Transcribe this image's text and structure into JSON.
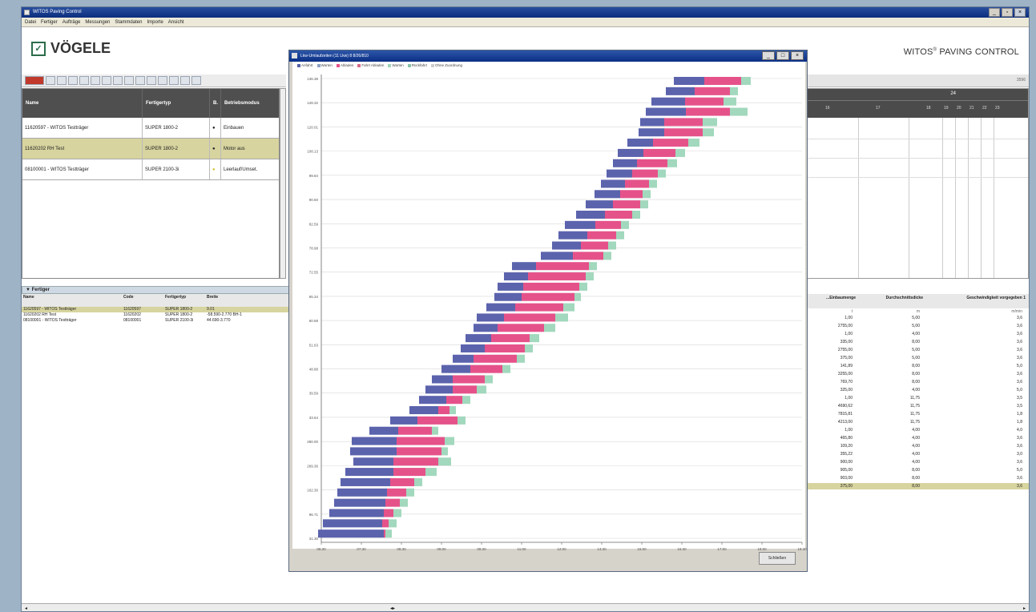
{
  "main_window": {
    "title": "WITOS Paving Control",
    "menu": [
      "Datei",
      "Fertiger",
      "Aufträge",
      "Messungen",
      "Stammdaten",
      "Importe",
      "Ansicht"
    ]
  },
  "brand": {
    "logo": "VÖGELE",
    "product": "WITOS",
    "product_sup": "®",
    "product_rest": " PAVING CONTROL"
  },
  "icons": [
    "window-minimize-icon",
    "window-maximize-icon",
    "window-close-icon",
    "logo-icon"
  ],
  "status_right": "3596",
  "top_grid": {
    "columns": [
      "Name",
      "Fertigertyp",
      "B.",
      "Betriebsmodus"
    ],
    "rows": [
      {
        "name": "11620597 - WITOS Testträger",
        "type": "SUPER 1800-2",
        "mode": "Einbauen",
        "dot": "#2a2a2a"
      },
      {
        "name": "11620202 RH Test",
        "type": "SUPER 1800-2",
        "mode": "Motor aus",
        "dot": "#2a2a2a"
      },
      {
        "name": "08100001 - WITOS Testträger",
        "type": "SUPER 2100-3i",
        "mode": "Leerlauf/Umset.",
        "dot": "#d6c23a"
      }
    ]
  },
  "fleet_panel": {
    "title": "Fertiger",
    "columns": [
      "Name",
      "Code",
      "Fertigertyp",
      "Breite"
    ],
    "rows": [
      {
        "name": "11620597 - WITOS Testträger",
        "code": "11620597",
        "type": "SUPER 1800-2",
        "width": "9.01"
      },
      {
        "name": "11620202 RH Test",
        "code": "11620202",
        "type": "SUPER 1800-2",
        "width": "-58.590-2.770 BH-1"
      },
      {
        "name": "08100001 - WITOS Testträger",
        "code": "08100001",
        "type": "SUPER 2100-3i",
        "width": "44.690-3.770"
      }
    ]
  },
  "timeline": {
    "week": "24",
    "days_left": [
      "16",
      "17",
      "18"
    ],
    "days_right": [
      "19",
      "20",
      "21",
      "22",
      "23"
    ]
  },
  "right_table": {
    "columns": [
      "...Einbaumenge",
      "Durchschnittsdicke",
      "Geschwindigkeit vorgegeben 1"
    ],
    "units": [
      "t",
      "m",
      "m/min"
    ],
    "rows": [
      [
        "1,00",
        "5,00",
        "3,6"
      ],
      [
        "2755,00",
        "5,00",
        "3,6"
      ],
      [
        "1,00",
        "4,00",
        "3,6"
      ],
      [
        "335,00",
        "8,00",
        "3,6"
      ],
      [
        "2755,00",
        "5,00",
        "3,6"
      ],
      [
        "375,00",
        "5,00",
        "3,6"
      ],
      [
        "141,89",
        "8,00",
        "5,0"
      ],
      [
        "3255,00",
        "8,00",
        "3,6"
      ],
      [
        "769,70",
        "8,00",
        "3,6"
      ],
      [
        "325,00",
        "4,00",
        "5,0"
      ],
      [
        "1,00",
        "11,75",
        "3,5"
      ],
      [
        "4690,62",
        "11,75",
        "3,5"
      ],
      [
        "7815,81",
        "11,75",
        "1,8"
      ],
      [
        "4213,00",
        "11,75",
        "1,8"
      ],
      [
        "1,00",
        "4,00",
        "4,0"
      ],
      [
        "465,80",
        "4,00",
        "3,6"
      ],
      [
        "109,20",
        "4,00",
        "3,6"
      ],
      [
        "355,22",
        "4,00",
        "3,0"
      ],
      [
        "900,00",
        "4,00",
        "3,6"
      ],
      [
        "905,00",
        "8,00",
        "5,0"
      ],
      [
        "903,00",
        "8,00",
        "3,6"
      ],
      [
        "375,00",
        "8,00",
        "3,6"
      ]
    ],
    "selected_row": 21
  },
  "chart_window": {
    "title": "Lkw-Umlaufzeiten (11 Lkw) 8 8/26/810",
    "close_label": "Schließen",
    "legend": [
      {
        "label": "Anfahrt",
        "color": "#5561a6"
      },
      {
        "label": "Warten",
        "color": "#8da0c4"
      },
      {
        "label": "Abladen",
        "color": "#e5528a"
      },
      {
        "label": "Fahrt Abladen",
        "color": "#d46a8a"
      },
      {
        "label": "Warten",
        "color": "#a0d6b8"
      },
      {
        "label": "Rückfahrt",
        "color": "#8ac4a8"
      },
      {
        "label": "Ohne Zuordnung",
        "color": "#cccccc"
      }
    ]
  },
  "chart_data": {
    "type": "bar",
    "orientation": "horizontal-stacked",
    "ylabel": "",
    "xlabel": "",
    "x_ticks": [
      "06:30",
      "07:30",
      "08:30",
      "09:00",
      "09:30",
      "11:00",
      "12:00",
      "13:30",
      "15:00",
      "16:30",
      "17:00",
      "18:00",
      "18:30"
    ],
    "y_ticks": [
      "136.38",
      "128.32",
      "120.01",
      "108.13",
      "99.84",
      "90.50",
      "82.59",
      "78.98",
      "72.55",
      "65.34",
      "60.68",
      "51.63",
      "48.88",
      "39.59",
      "33.64",
      "280.00",
      "269.36",
      "162.30",
      "96.71",
      "31.30"
    ],
    "series_colors": [
      "#5b63ad",
      "#e5528a",
      "#a2d8bd"
    ],
    "bars": [
      [
        840,
        38,
        46,
        12
      ],
      [
        830,
        36,
        44,
        10
      ],
      [
        812,
        42,
        48,
        16
      ],
      [
        805,
        50,
        55,
        22
      ],
      [
        798,
        30,
        48,
        18
      ],
      [
        796,
        32,
        48,
        14
      ],
      [
        782,
        32,
        44,
        14
      ],
      [
        770,
        32,
        40,
        12
      ],
      [
        764,
        30,
        38,
        12
      ],
      [
        756,
        32,
        32,
        10
      ],
      [
        749,
        30,
        30,
        10
      ],
      [
        741,
        32,
        28,
        10
      ],
      [
        730,
        34,
        34,
        10
      ],
      [
        718,
        36,
        34,
        10
      ],
      [
        704,
        38,
        32,
        10
      ],
      [
        696,
        36,
        36,
        10
      ],
      [
        688,
        36,
        34,
        10
      ],
      [
        674,
        40,
        38,
        10
      ],
      [
        638,
        30,
        66,
        10
      ],
      [
        628,
        30,
        72,
        10
      ],
      [
        620,
        32,
        70,
        10
      ],
      [
        616,
        34,
        66,
        8
      ],
      [
        606,
        36,
        60,
        14
      ],
      [
        594,
        34,
        64,
        16
      ],
      [
        590,
        30,
        58,
        14
      ],
      [
        580,
        32,
        48,
        12
      ],
      [
        574,
        30,
        50,
        10
      ],
      [
        564,
        26,
        54,
        10
      ],
      [
        550,
        36,
        40,
        10
      ],
      [
        538,
        26,
        40,
        10
      ],
      [
        530,
        34,
        30,
        12
      ],
      [
        522,
        34,
        20,
        10
      ],
      [
        510,
        36,
        14,
        8
      ],
      [
        486,
        34,
        50,
        10
      ],
      [
        460,
        36,
        42,
        8
      ],
      [
        438,
        56,
        60,
        12
      ],
      [
        436,
        58,
        56,
        8
      ],
      [
        440,
        50,
        56,
        16
      ],
      [
        430,
        60,
        40,
        14
      ],
      [
        424,
        62,
        30,
        10
      ],
      [
        420,
        62,
        24,
        10
      ],
      [
        416,
        64,
        18,
        10
      ],
      [
        410,
        68,
        12,
        10
      ],
      [
        402,
        74,
        8,
        10
      ],
      [
        396,
        82,
        2,
        8
      ]
    ]
  }
}
